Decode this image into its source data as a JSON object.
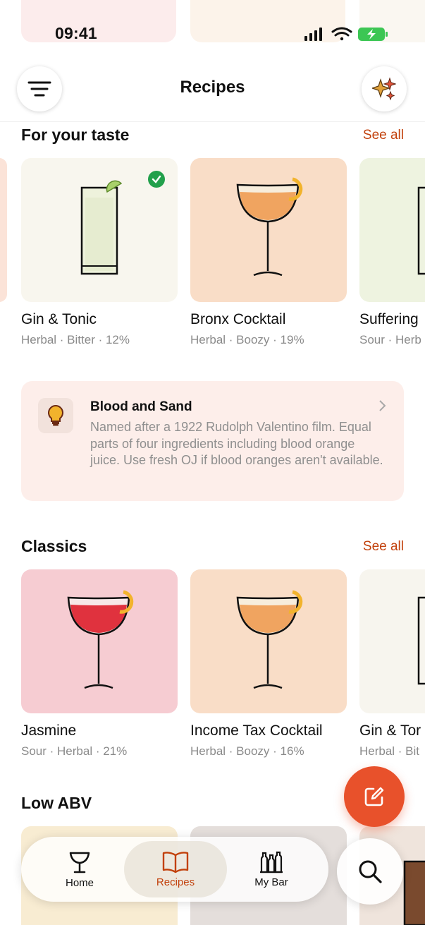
{
  "status_bar": {
    "time": "09:41"
  },
  "header": {
    "title": "Recipes",
    "filter_icon": "filter-lines-icon",
    "ai_icon": "sparkles-icon"
  },
  "sections": {
    "for_your_taste": {
      "title": "For your taste",
      "see_all": "See all",
      "cards": [
        {
          "name": "Gin & Tonic",
          "tags": "Herbal · Bitter · 12%"
        },
        {
          "name": "Bronx Cocktail",
          "tags": "Herbal · Boozy · 19%"
        },
        {
          "name": "Suffering",
          "tags": "Sour · Herb"
        }
      ]
    },
    "tip": {
      "title": "Blood and Sand",
      "body": "Named after a 1922 Rudolph Valentino film. Equal parts of four ingredients including blood orange juice. Use fresh OJ if blood oranges aren't available.",
      "icon": "lightbulb-icon"
    },
    "classics": {
      "title": "Classics",
      "see_all": "See all",
      "cards": [
        {
          "name": "Jasmine",
          "tags": "Sour · Herbal · 21%"
        },
        {
          "name": "Income Tax Cocktail",
          "tags": "Herbal · Boozy · 16%"
        },
        {
          "name": "Gin & Tor",
          "tags": "Herbal · Bit"
        }
      ]
    },
    "low_abv": {
      "title": "Low ABV"
    }
  },
  "tabbar": {
    "tabs": [
      {
        "label": "Home",
        "icon": "cocktail-glass-icon"
      },
      {
        "label": "Recipes",
        "icon": "open-book-icon",
        "active": true
      },
      {
        "label": "My Bar",
        "icon": "bottles-icon"
      }
    ],
    "search_icon": "search-icon"
  },
  "colors": {
    "accent": "#c2410c",
    "fab": "#e8512b",
    "checkmark": "#22a04b"
  }
}
